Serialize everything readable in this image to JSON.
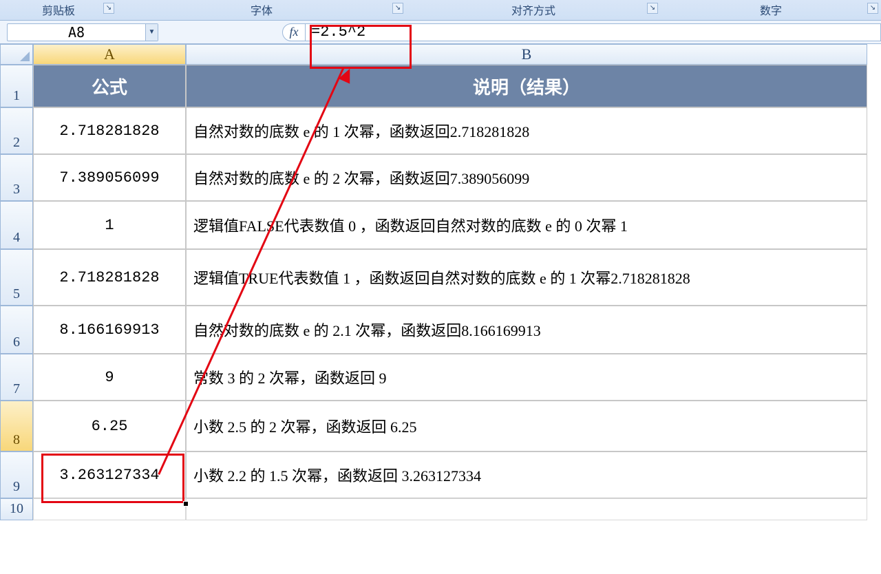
{
  "ribbon": {
    "groups": [
      "剪贴板",
      "字体",
      "对齐方式",
      "数字"
    ]
  },
  "namebox": {
    "value": "A8"
  },
  "fx": {
    "label": "fx"
  },
  "formula": {
    "value": "=2.5^2"
  },
  "columns": [
    "A",
    "B"
  ],
  "header_row": {
    "a": "公式",
    "b": "说明（结果）"
  },
  "rows": [
    {
      "n": "1"
    },
    {
      "n": "2",
      "a": "2.718281828",
      "b": "自然对数的底数 e 的 1 次幂，函数返回2.718281828"
    },
    {
      "n": "3",
      "a": "7.389056099",
      "b": "自然对数的底数 e 的 2 次幂，函数返回7.389056099"
    },
    {
      "n": "4",
      "a": "1",
      "b": "逻辑值FALSE代表数值 0 ，函数返回自然对数的底数 e 的 0 次幂 1"
    },
    {
      "n": "5",
      "a": "2.718281828",
      "b": "逻辑值TRUE代表数值 1 ，函数返回自然对数的底数 e 的 1 次幂2.718281828"
    },
    {
      "n": "6",
      "a": "8.166169913",
      "b": "自然对数的底数 e 的 2.1 次幂，函数返回8.166169913"
    },
    {
      "n": "7",
      "a": "9",
      "b": "常数 3 的 2 次幂，函数返回 9"
    },
    {
      "n": "8",
      "a": "6.25",
      "b": "小数 2.5 的 2 次幂，函数返回 6.25"
    },
    {
      "n": "9",
      "a": "3.263127334",
      "b": "小数 2.2 的 1.5 次幂，函数返回 3.263127334"
    },
    {
      "n": "10"
    }
  ],
  "chart_data": {
    "type": "table",
    "title": "Excel 指数/幂函数示例",
    "columns": [
      "公式",
      "说明（结果）"
    ],
    "rows": [
      [
        "2.718281828",
        "自然对数的底数 e 的 1 次幂，函数返回2.718281828"
      ],
      [
        "7.389056099",
        "自然对数的底数 e 的 2 次幂，函数返回7.389056099"
      ],
      [
        "1",
        "逻辑值FALSE代表数值 0 ，函数返回自然对数的底数 e 的 0 次幂 1"
      ],
      [
        "2.718281828",
        "逻辑值TRUE代表数值 1 ，函数返回自然对数的底数 e 的 1 次幂2.718281828"
      ],
      [
        "8.166169913",
        "自然对数的底数 e 的 2.1 次幂，函数返回8.166169913"
      ],
      [
        "9",
        "常数 3 的 2 次幂，函数返回 9"
      ],
      [
        "6.25",
        "小数 2.5 的 2 次幂，函数返回 6.25"
      ],
      [
        "3.263127334",
        "小数 2.2 的 1.5 次幂，函数返回 3.263127334"
      ]
    ],
    "selected_cell": "A8",
    "selected_formula": "=2.5^2"
  }
}
